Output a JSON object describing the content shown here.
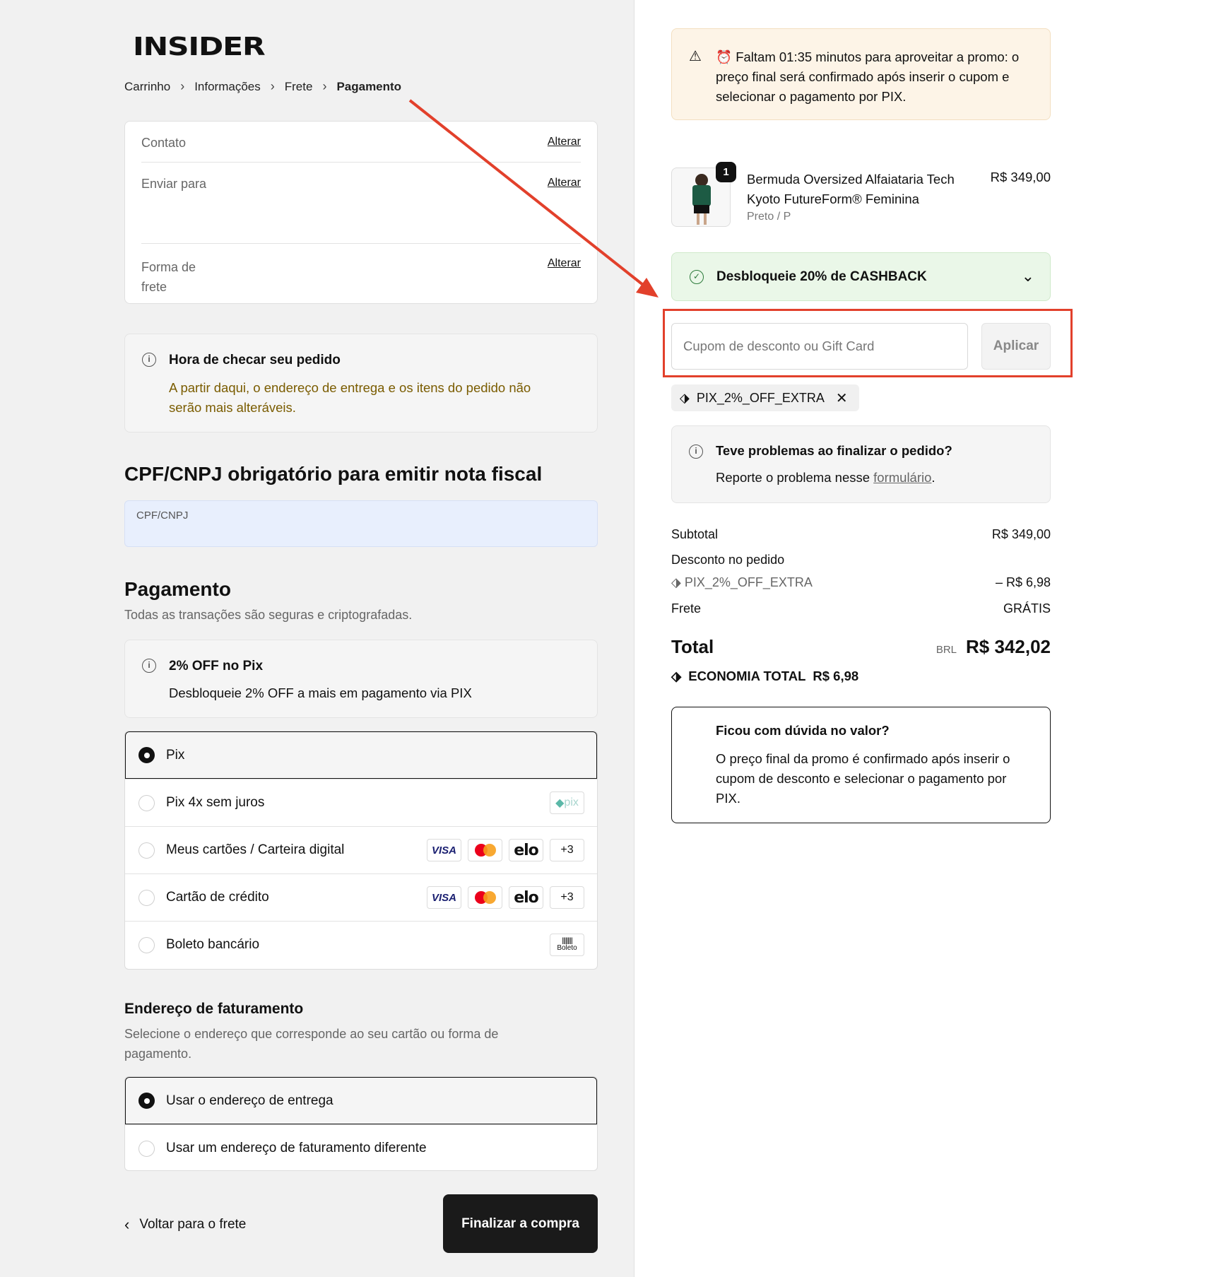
{
  "brand": {
    "logo_text": "INSIDER"
  },
  "breadcrumb": {
    "items": [
      "Carrinho",
      "Informações",
      "Frete",
      "Pagamento"
    ]
  },
  "summary": {
    "contact_label": "Contato",
    "ship_to_label": "Enviar para",
    "shipping_method_label": "Forma de frete",
    "change_label": "Alterar"
  },
  "notice": {
    "title": "Hora de checar seu pedido",
    "text": "A partir daqui, o endereço de entrega e os itens do pedido não serão mais alteráveis."
  },
  "cpf": {
    "heading": "CPF/CNPJ obrigatório para emitir nota fiscal",
    "placeholder": "CPF/CNPJ"
  },
  "payment": {
    "heading": "Pagamento",
    "subtitle": "Todas as transações são seguras e criptografadas.",
    "promo_title": "2% OFF no Pix",
    "promo_text": "Desbloqueie 2% OFF a mais em pagamento via PIX",
    "options": [
      {
        "label": "Pix",
        "selected": true
      },
      {
        "label": "Pix 4x sem juros",
        "selected": false,
        "badge": "pix"
      },
      {
        "label": "Meus cartões / Carteira digital",
        "selected": false
      },
      {
        "label": "Cartão de crédito",
        "selected": false
      },
      {
        "label": "Boleto bancário",
        "selected": false,
        "badge": "Boleto"
      }
    ],
    "brand_labels": {
      "visa": "VISA",
      "elo": "elo",
      "more": "+3"
    }
  },
  "billing": {
    "heading": "Endereço de faturamento",
    "subtitle": "Selecione o endereço que corresponde ao seu cartão ou forma de pagamento.",
    "options": [
      {
        "label": "Usar o endereço de entrega",
        "selected": true
      },
      {
        "label": "Usar um endereço de faturamento diferente",
        "selected": false
      }
    ]
  },
  "footer": {
    "back_label": "Voltar para o frete",
    "submit_label": "Finalizar a compra"
  },
  "promo_banner": {
    "emoji": "⏰",
    "text": "Faltam 01:35 minutos para aproveitar a promo: o preço final será confirmado após inserir o cupom e selecionar o pagamento por PIX."
  },
  "product": {
    "quantity": "1",
    "name": "Bermuda Oversized Alfaiataria Tech Kyoto FutureForm® Feminina",
    "variant": "Preto / P",
    "price": "R$ 349,00"
  },
  "cashback": {
    "label": "Desbloqueie 20% de CASHBACK"
  },
  "coupon": {
    "placeholder": "Cupom de desconto ou Gift Card",
    "apply_label": "Aplicar",
    "applied_code": "PIX_2%_OFF_EXTRA"
  },
  "help": {
    "title": "Teve problemas ao finalizar o pedido?",
    "text_before": "Reporte o problema nesse ",
    "link": "formulário",
    "text_after": "."
  },
  "totals": {
    "subtotal_label": "Subtotal",
    "subtotal_value": "R$ 349,00",
    "discount_label": "Desconto no pedido",
    "discount_code": "PIX_2%_OFF_EXTRA",
    "discount_value": "– R$ 6,98",
    "shipping_label": "Frete",
    "shipping_value": "GRÁTIS",
    "total_label": "Total",
    "currency": "BRL",
    "total_value": "R$ 342,02",
    "savings_label": "ECONOMIA TOTAL",
    "savings_value": "R$ 6,98"
  },
  "doubt": {
    "title": "Ficou com dúvida no valor?",
    "text": "O preço final da promo é confirmado após inserir o cupom de desconto e selecionar o pagamento por PIX."
  },
  "colors": {
    "accent_dark": "#1a1a1a",
    "annotation_red": "#e2402b",
    "notice_text": "#7a5c00",
    "cashback_bg": "#eaf7e8"
  }
}
